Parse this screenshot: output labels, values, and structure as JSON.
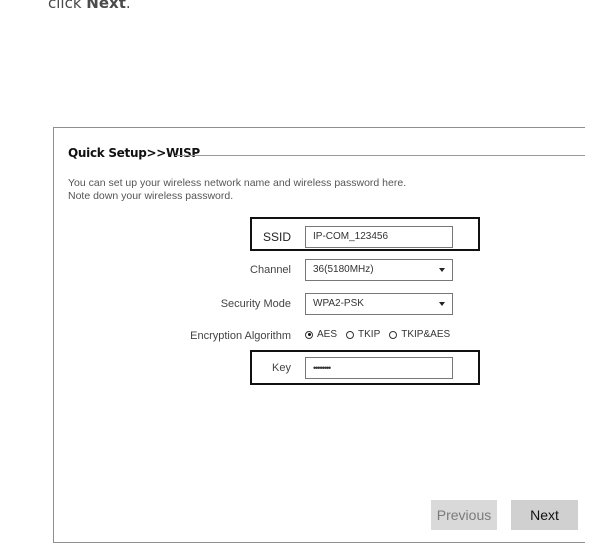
{
  "caption": {
    "prefix": "click ",
    "bold": "Next",
    "suffix": "."
  },
  "panel": {
    "title": "Quick Setup>>WISP",
    "description_line1": "You can set up your wireless network name and wireless password here.",
    "description_line2": "Note down your wireless password."
  },
  "form": {
    "ssid": {
      "label": "SSID",
      "value": "IP-COM_123456"
    },
    "channel": {
      "label": "Channel",
      "value": "36(5180MHz)"
    },
    "security_mode": {
      "label": "Security Mode",
      "value": "WPA2-PSK"
    },
    "encryption": {
      "label": "Encryption Algorithm",
      "options": [
        "AES",
        "TKIP",
        "TKIP&AES"
      ],
      "selected": "AES"
    },
    "key": {
      "label": "Key",
      "value": "••••••••"
    }
  },
  "buttons": {
    "previous": "Previous",
    "next": "Next"
  },
  "colors": {
    "highlight_border": "#111111",
    "button_bg": "#d0d0d0"
  }
}
